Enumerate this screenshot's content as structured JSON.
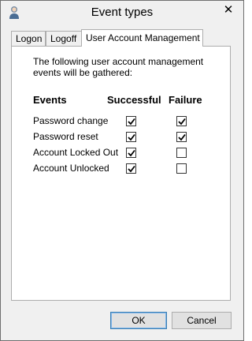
{
  "window": {
    "title": "Event types",
    "close_glyph": "✕",
    "app_icon": "user-icon"
  },
  "tabs": [
    {
      "label": "Logon",
      "active": false
    },
    {
      "label": "Logoff",
      "active": false
    },
    {
      "label": "User Account Management",
      "active": true
    }
  ],
  "panel": {
    "intro": "The following user account management events will be gathered:",
    "headers": {
      "events": "Events",
      "successful": "Successful",
      "failure": "Failure"
    },
    "rows": [
      {
        "label": "Password change",
        "successful": true,
        "failure": true
      },
      {
        "label": "Password reset",
        "successful": true,
        "failure": true
      },
      {
        "label": "Account Locked Out",
        "successful": true,
        "failure": false
      },
      {
        "label": "Account Unlocked",
        "successful": true,
        "failure": false
      }
    ]
  },
  "buttons": {
    "ok": "OK",
    "cancel": "Cancel"
  }
}
